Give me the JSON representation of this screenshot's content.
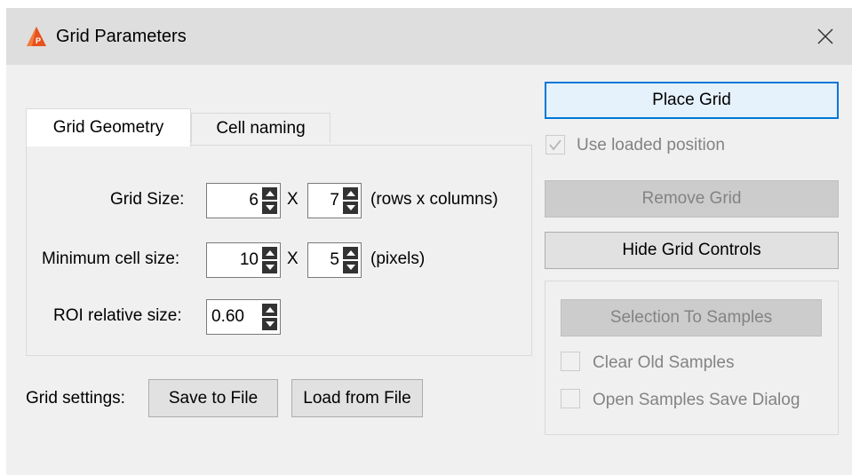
{
  "window": {
    "title": "Grid Parameters",
    "app_icon": "app-logo-icon",
    "close_icon": "close-icon"
  },
  "tabs": [
    {
      "label": "Grid Geometry",
      "active": true
    },
    {
      "label": "Cell naming",
      "active": false
    }
  ],
  "geometry": {
    "grid_size_label": "Grid Size:",
    "grid_rows": "6",
    "grid_cols": "7",
    "x_sep": "X",
    "grid_units": "(rows x columns)",
    "min_cell_label": "Minimum cell size:",
    "min_cell_w": "10",
    "min_cell_h": "5",
    "min_cell_units": "(pixels)",
    "roi_label": "ROI relative size:",
    "roi_value": "0.60"
  },
  "settings": {
    "label": "Grid settings:",
    "save_label": "Save to File",
    "load_label": "Load from File"
  },
  "actions": {
    "place_grid": "Place Grid",
    "use_loaded_position": "Use loaded position",
    "use_loaded_position_checked": true,
    "remove_grid": "Remove Grid",
    "hide_grid_controls": "Hide Grid Controls",
    "selection_to_samples": "Selection To Samples",
    "clear_old_samples": "Clear Old Samples",
    "open_samples_save_dialog": "Open Samples Save Dialog"
  },
  "colors": {
    "accent": "#0078d7",
    "window_bg": "#f0f0f0",
    "titlebar_bg": "#dedede",
    "disabled_text": "#838383"
  }
}
